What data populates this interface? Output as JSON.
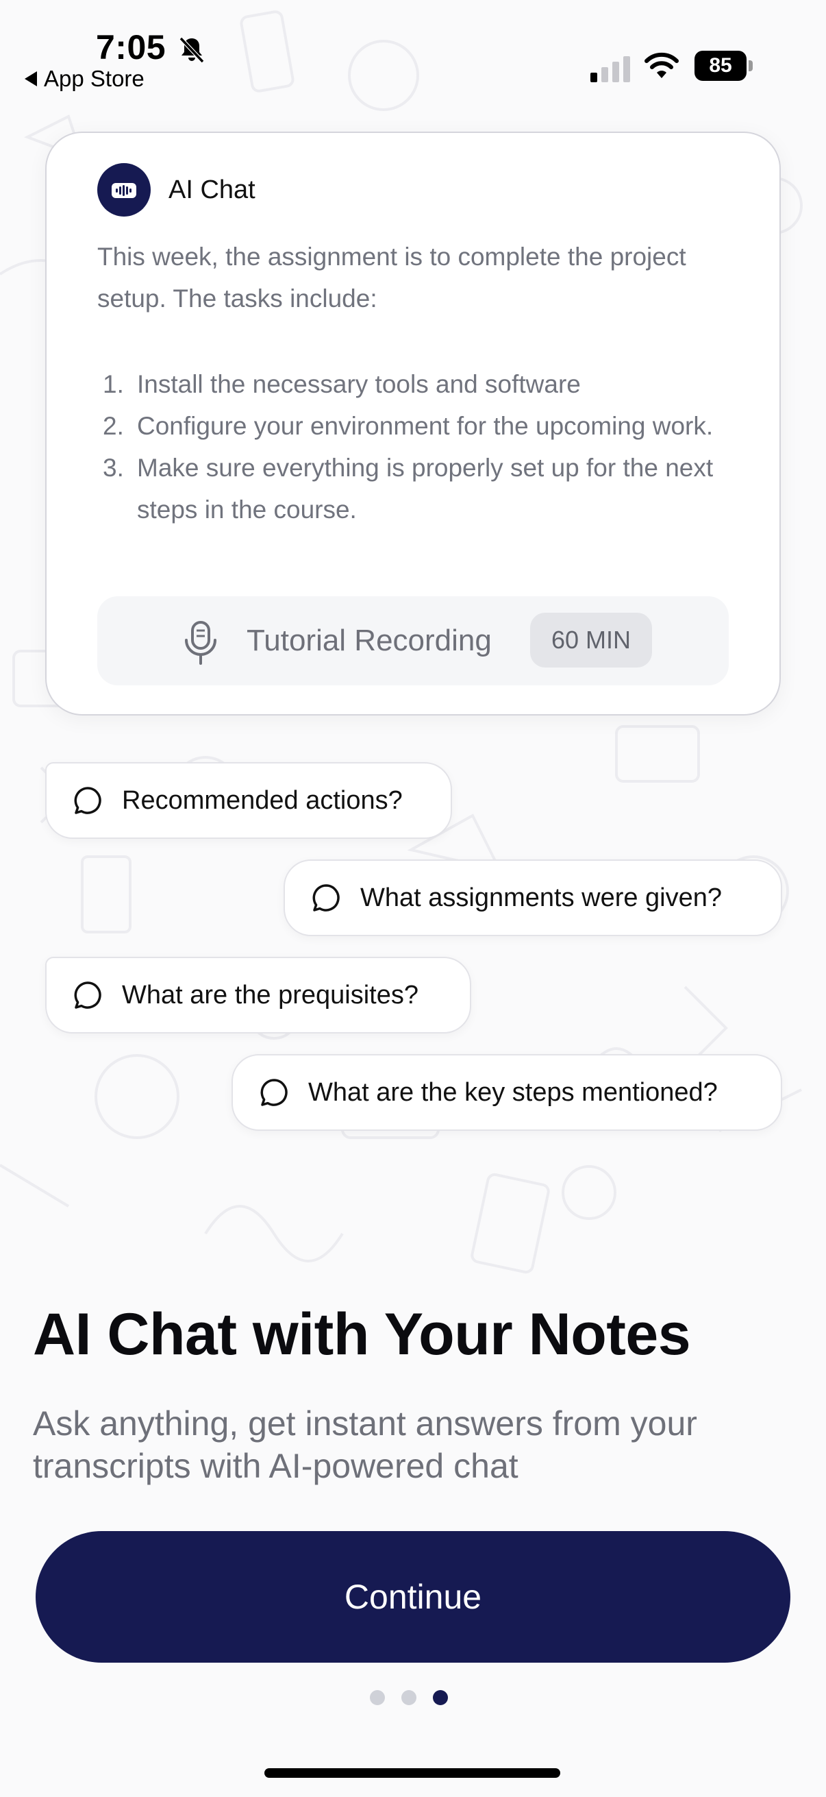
{
  "status_bar": {
    "time": "7:05",
    "back_app": "App Store",
    "battery": "85"
  },
  "chat_card": {
    "title": "AI Chat",
    "intro": "This week, the assignment is to complete the project setup. The tasks include:",
    "tasks": [
      {
        "num": "1.",
        "text": "Install the necessary tools and software"
      },
      {
        "num": "2.",
        "text": "Configure your environment for the upcoming work."
      },
      {
        "num": "3.",
        "text": "Make sure everything is properly set up for the next steps in the course."
      }
    ],
    "recording": {
      "label": "Tutorial Recording",
      "duration": "60 MIN"
    }
  },
  "suggestions": [
    "Recommended actions?",
    "What assignments were given?",
    "What are the prequisites?",
    "What are the key steps mentioned?"
  ],
  "hero": {
    "title": "AI Chat with Your Notes",
    "subtitle": "Ask anything, get instant answers from your transcripts with AI-powered chat"
  },
  "continue_label": "Continue",
  "pagination": {
    "total": 3,
    "active": 3
  },
  "colors": {
    "brand": "#161a52",
    "muted_text": "#6e7079"
  }
}
